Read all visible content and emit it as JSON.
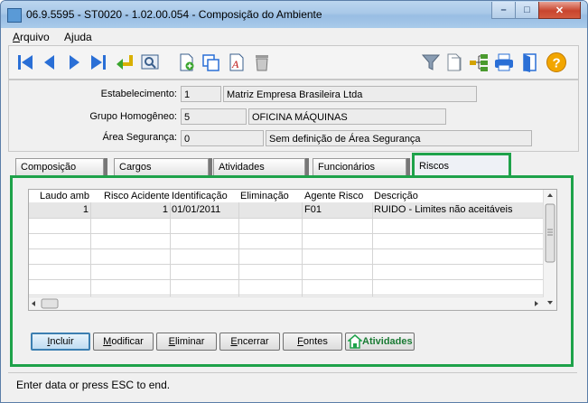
{
  "window": {
    "title": "06.9.5595 - ST0020 - 1.02.00.054 - Composição do Ambiente",
    "minimize": "–",
    "restore": "□",
    "close": "✕"
  },
  "menubar": {
    "items": [
      {
        "label": "Arquivo",
        "accel": "A",
        "rest": "rquivo"
      },
      {
        "label": "Ajuda",
        "accel": "j",
        "pre": "A",
        "rest": "uda"
      }
    ]
  },
  "toolbar": {
    "icons": [
      "first-icon",
      "previous-icon",
      "next-icon",
      "last-icon",
      "return-icon",
      "search-icon",
      "new-document-icon",
      "copy-icon",
      "edit-text-icon",
      "delete-icon",
      "filter-icon",
      "clipboard-icon",
      "tree-icon",
      "print-icon",
      "exit-icon",
      "help-icon"
    ]
  },
  "header": {
    "estabelecimento_label": "Estabelecimento:",
    "estabelecimento_code": "1",
    "estabelecimento_name": "Matriz Empresa Brasileira Ltda",
    "grupo_label": "Grupo Homogêneo:",
    "grupo_code": "5",
    "grupo_name": "OFICINA MÁQUINAS",
    "area_label": "Área Segurança:",
    "area_code": "0",
    "area_name": "Sem definição de Área Segurança"
  },
  "tabs": [
    {
      "label": "Composição"
    },
    {
      "label": "Cargos"
    },
    {
      "label": "Atividades"
    },
    {
      "label": "Funcionários"
    },
    {
      "label": "Riscos"
    }
  ],
  "grid": {
    "columns": [
      "Laudo amb",
      "Risco Acidente",
      "Identificação",
      "Eliminação",
      "Agente Risco",
      "Descrição"
    ],
    "rows": [
      {
        "laudo": "1",
        "risco": "1",
        "identificacao": "01/01/2011",
        "eliminacao": "",
        "agente": "F01",
        "descricao": "RUIDO - Limites não aceitáveis"
      }
    ]
  },
  "buttons": {
    "incluir": {
      "label": "Incluir",
      "u": "I",
      "rest": "ncluir"
    },
    "modificar": {
      "label": "Modificar",
      "u": "M",
      "rest": "odificar"
    },
    "eliminar": {
      "label": "Eliminar",
      "u": "E",
      "rest": "liminar"
    },
    "encerrar": {
      "label": "Encerrar",
      "u": "E",
      "rest": "ncerrar"
    },
    "fontes": {
      "label": "Fontes",
      "u": "F",
      "rest": "ontes"
    },
    "atividades": {
      "label": "Atividades"
    }
  },
  "status": {
    "text": "Enter data or press ESC to end."
  },
  "colors": {
    "accent_green": "#1ea24a",
    "nav_blue": "#2a6fd6"
  }
}
